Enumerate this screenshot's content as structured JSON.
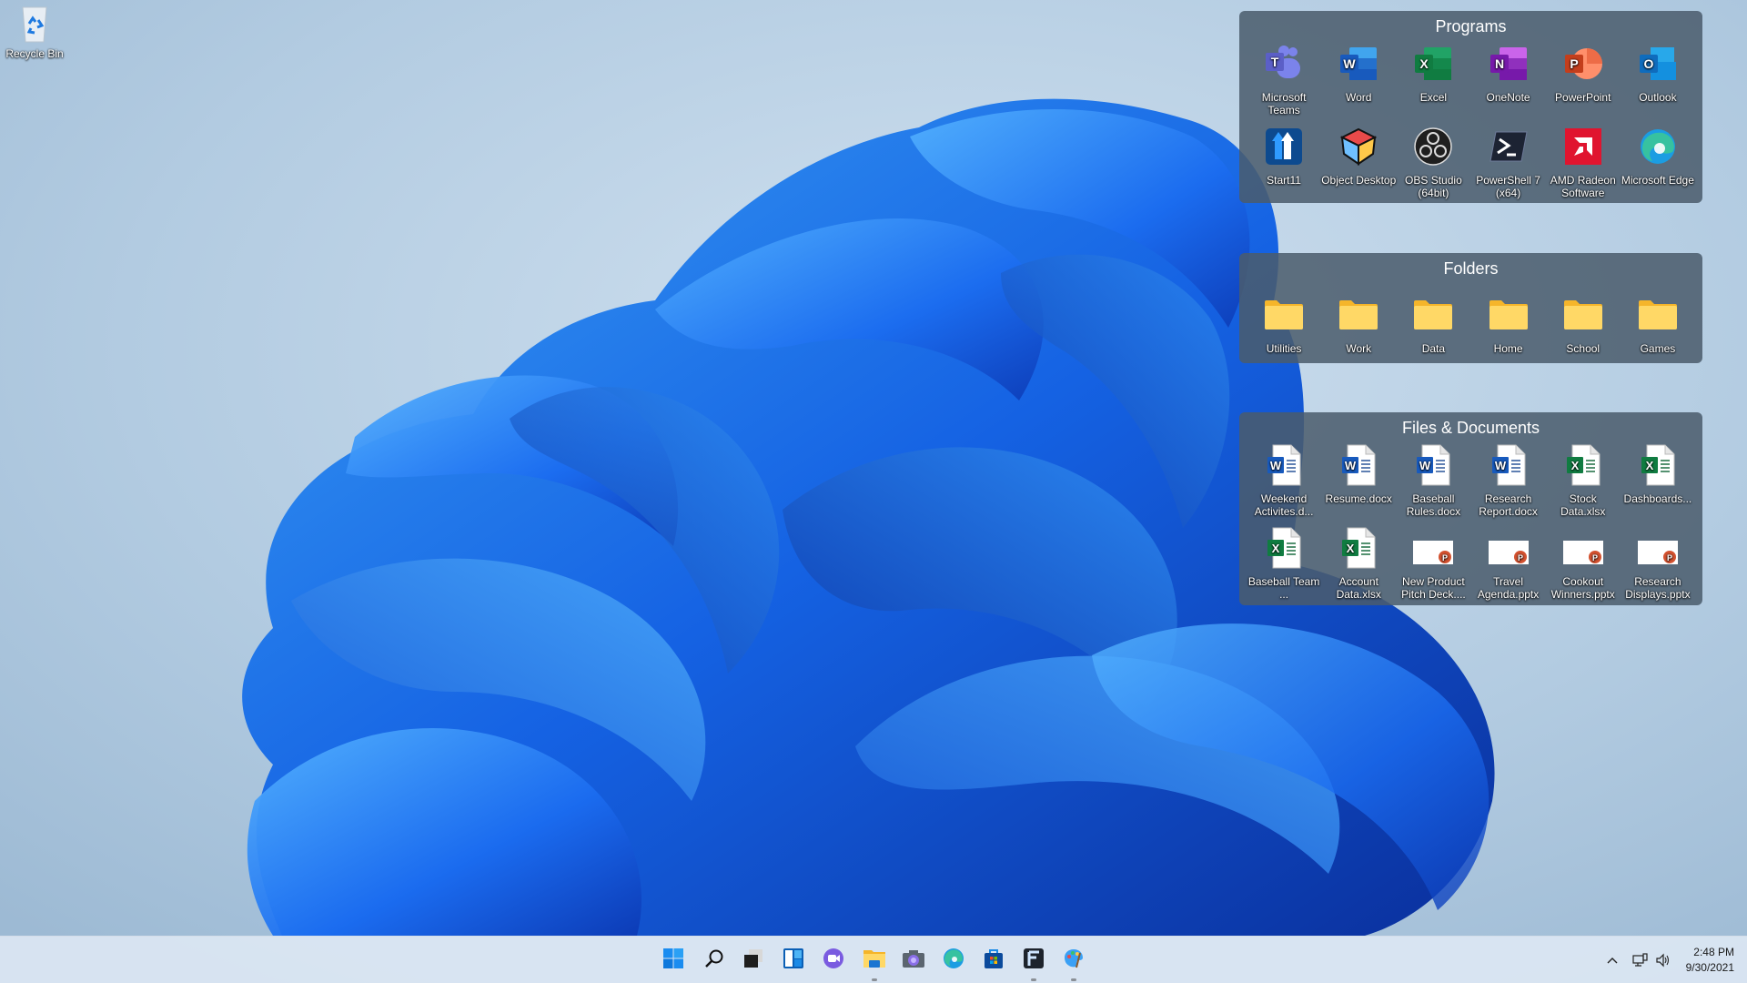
{
  "desktop": {
    "icons": [
      {
        "label": "Recycle Bin",
        "icon": "recycle-bin-icon"
      }
    ]
  },
  "fences": {
    "programs": {
      "title": "Programs",
      "items": [
        {
          "label": "Microsoft Teams",
          "icon": "teams-icon",
          "color": "#5b5fc7"
        },
        {
          "label": "Word",
          "icon": "word-icon",
          "color": "#185abd"
        },
        {
          "label": "Excel",
          "icon": "excel-icon",
          "color": "#107c41"
        },
        {
          "label": "OneNote",
          "icon": "onenote-icon",
          "color": "#7719aa"
        },
        {
          "label": "PowerPoint",
          "icon": "powerpoint-icon",
          "color": "#c43e1c"
        },
        {
          "label": "Outlook",
          "icon": "outlook-icon",
          "color": "#0f6cbd"
        },
        {
          "label": "Start11",
          "icon": "start11-icon",
          "color": "#0d4a8f"
        },
        {
          "label": "Object Desktop",
          "icon": "object-desktop-icon",
          "color": "#e84a4a"
        },
        {
          "label": "OBS Studio (64bit)",
          "icon": "obs-studio-icon",
          "color": "#1f1f1f"
        },
        {
          "label": "PowerShell 7 (x64)",
          "icon": "powershell-icon",
          "color": "#1c2333"
        },
        {
          "label": "AMD Radeon Software",
          "icon": "amd-radeon-icon",
          "color": "#e0142f"
        },
        {
          "label": "Microsoft Edge",
          "icon": "edge-icon",
          "color": "#1b9de2"
        }
      ]
    },
    "folders": {
      "title": "Folders",
      "items": [
        {
          "label": "Utilities",
          "icon": "folder-icon"
        },
        {
          "label": "Work",
          "icon": "folder-icon"
        },
        {
          "label": "Data",
          "icon": "folder-icon"
        },
        {
          "label": "Home",
          "icon": "folder-icon"
        },
        {
          "label": "School",
          "icon": "folder-icon"
        },
        {
          "label": "Games",
          "icon": "folder-icon"
        }
      ]
    },
    "files": {
      "title": "Files & Documents",
      "items": [
        {
          "label": "Weekend Activites.d...",
          "icon": "docx-file-icon",
          "type": "word"
        },
        {
          "label": "Resume.docx",
          "icon": "docx-file-icon",
          "type": "word"
        },
        {
          "label": "Baseball Rules.docx",
          "icon": "docx-file-icon",
          "type": "word"
        },
        {
          "label": "Research Report.docx",
          "icon": "docx-file-icon",
          "type": "word"
        },
        {
          "label": "Stock Data.xlsx",
          "icon": "xlsx-file-icon",
          "type": "excel"
        },
        {
          "label": "Dashboards...",
          "icon": "xlsx-file-icon",
          "type": "excel"
        },
        {
          "label": "Baseball Team ...",
          "icon": "xlsx-file-icon",
          "type": "excel"
        },
        {
          "label": "Account Data.xlsx",
          "icon": "xlsx-file-icon",
          "type": "excel"
        },
        {
          "label": "New Product Pitch Deck....",
          "icon": "pptx-file-icon",
          "type": "ppt"
        },
        {
          "label": "Travel Agenda.pptx",
          "icon": "pptx-file-icon",
          "type": "ppt"
        },
        {
          "label": "Cookout Winners.pptx",
          "icon": "pptx-file-icon",
          "type": "ppt"
        },
        {
          "label": "Research Displays.pptx",
          "icon": "pptx-file-icon",
          "type": "ppt"
        }
      ]
    }
  },
  "taskbar": {
    "apps": [
      {
        "name": "start-button",
        "icon": "windows-start-icon",
        "running": false
      },
      {
        "name": "search-button",
        "icon": "search-icon",
        "running": false
      },
      {
        "name": "task-view-button",
        "icon": "task-view-icon",
        "running": false
      },
      {
        "name": "widgets-button",
        "icon": "widgets-icon",
        "running": false
      },
      {
        "name": "chat-button",
        "icon": "teams-chat-icon",
        "running": false
      },
      {
        "name": "file-explorer-button",
        "icon": "file-explorer-icon",
        "running": true
      },
      {
        "name": "camera-button",
        "icon": "camera-icon",
        "running": false
      },
      {
        "name": "edge-button",
        "icon": "edge-icon",
        "running": false
      },
      {
        "name": "store-button",
        "icon": "microsoft-store-icon",
        "running": false
      },
      {
        "name": "fences-button",
        "icon": "fences-icon",
        "running": true
      },
      {
        "name": "paint-button",
        "icon": "paint-icon",
        "running": true
      }
    ],
    "tray": {
      "chevron": "chevron-up-icon",
      "network": "network-icon",
      "volume": "volume-icon",
      "time": "2:48 PM",
      "date": "9/30/2021"
    }
  },
  "colors": {
    "fence_bg": "#4b5c6c",
    "taskbar_bg": "#dce6f3",
    "folder": "#ffd35c",
    "accent_blue": "#0078d4"
  }
}
